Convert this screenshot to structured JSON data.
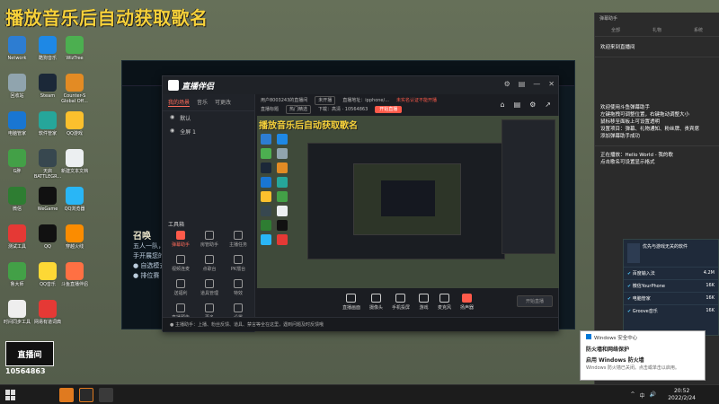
{
  "headline": "播放音乐后自动获取歌名",
  "desktop_icons": [
    {
      "label": "Network",
      "icon": "network-icon",
      "color": "#2d7dd2"
    },
    {
      "label": "酷狗音乐",
      "icon": "kugou-icon",
      "color": "#1e88e5"
    },
    {
      "label": "WizTree",
      "icon": "wiztree-icon",
      "color": "#4caf50"
    },
    {
      "label": "回收站",
      "icon": "recycle-bin-icon",
      "color": "#90a4ae"
    },
    {
      "label": "Steam",
      "icon": "steam-icon",
      "color": "#1b2838"
    },
    {
      "label": "Counter-S Global Off...",
      "icon": "csgo-icon",
      "color": "#e38b24"
    },
    {
      "label": "电脑管家",
      "icon": "pc-manager-icon",
      "color": "#1976d2"
    },
    {
      "label": "软件管家",
      "icon": "software-manager-icon",
      "color": "#26a69a"
    },
    {
      "label": "QQ游戏",
      "icon": "qq-game-icon",
      "color": "#fbc02d"
    },
    {
      "label": "G胖",
      "icon": "g-icon",
      "color": "#43a047"
    },
    {
      "label": "天启 BATTLEGR...",
      "icon": "battlegrounds-icon",
      "color": "#37474f"
    },
    {
      "label": "新建文本文档",
      "icon": "text-doc-icon",
      "color": "#eceff1"
    },
    {
      "label": "微信",
      "icon": "wechat-icon",
      "color": "#2e7d32"
    },
    {
      "label": "WeGame",
      "icon": "wegame-icon",
      "color": "#111111"
    },
    {
      "label": "QQ浏览器",
      "icon": "qq-browser-icon",
      "color": "#29b6f6"
    },
    {
      "label": "测试工具",
      "icon": "test-tool-icon",
      "color": "#e53935"
    },
    {
      "label": "QQ",
      "icon": "qq-icon",
      "color": "#111111"
    },
    {
      "label": "穿越火线",
      "icon": "crossfire-icon",
      "color": "#fb8c00"
    },
    {
      "label": "鲁大师",
      "icon": "ludashi-icon",
      "color": "#43a047"
    },
    {
      "label": "QQ音乐",
      "icon": "qq-music-icon",
      "color": "#fdd835"
    },
    {
      "label": "斗鱼直播伴侣",
      "icon": "douyu-icon",
      "color": "#ff7043"
    },
    {
      "label": "时间同步工具",
      "icon": "time-sync-icon",
      "color": "#eeeeee"
    },
    {
      "label": "网易有道词典",
      "icon": "youdao-icon",
      "color": "#e53935"
    }
  ],
  "watermark": {
    "logo_text": "直播间",
    "number": "10564863"
  },
  "game_client": {
    "big_text": "召唤",
    "line1": "五人一队，",
    "line2": "手开展您的",
    "line3": "● 自选模式",
    "line4": "● 排位赛"
  },
  "app": {
    "brand": "直播伴侣",
    "window_controls": [
      "⚙",
      "▤",
      "—",
      "✕"
    ],
    "tabs": [
      "我的场景",
      "音乐",
      "可更改"
    ],
    "scenes": [
      {
        "label": "默认"
      },
      {
        "label": "全屏 1"
      }
    ],
    "tools_label": "工具箱",
    "tools": [
      {
        "label": "弹幕助手",
        "active": true
      },
      {
        "label": "房管助手",
        "active": false
      },
      {
        "label": "主播任务",
        "active": false
      },
      {
        "label": "视频连麦",
        "active": false
      },
      {
        "label": "点歌台",
        "active": false
      },
      {
        "label": "PK擂台",
        "active": false
      },
      {
        "label": "送福利",
        "active": false
      },
      {
        "label": "道具管理",
        "active": false
      },
      {
        "label": "特效",
        "active": false
      },
      {
        "label": "直播预告",
        "active": false
      },
      {
        "label": "更多",
        "active": false
      },
      {
        "label": "设置",
        "active": false
      }
    ],
    "info": {
      "user": "用户8003243的直播间",
      "status": "未开播",
      "link": "直播地址：ipphone/...",
      "warn": "未实名认证不能开播",
      "label2": "直播标题",
      "pill2": "热门精选",
      "detail2": "下载：高清 · 10564863",
      "button": "开始直播"
    },
    "action_icons": [
      "⌂",
      "▤",
      "⚙",
      "↗"
    ],
    "preview_title": "播放音乐后自动获取歌名",
    "bottom_buttons": [
      {
        "label": "直播画面",
        "active": false
      },
      {
        "label": "摄像头",
        "active": false
      },
      {
        "label": "手机投屏",
        "active": false
      },
      {
        "label": "游戏",
        "active": false
      },
      {
        "label": "麦克风",
        "active": false
      },
      {
        "label": "扬声器",
        "active": true
      }
    ],
    "start_live": "开始直播",
    "status_text": "● 主播助手：上播、粉丝反馈、道具、禁言等全在这里，遇到问题及时反馈哦"
  },
  "notification_panel": {
    "head": "弹幕助手",
    "tabs": [
      "全部",
      "礼物",
      "系统"
    ],
    "block1": "欢迎来到直播间",
    "block2_lines": [
      "欢迎使用斗鱼弹幕助手",
      "左键拖拽可调整位置，右键拖动调整大小",
      "鼠标移至面板上可设置透明",
      "设置项目：弹幕、礼物通知、粉丝牌、贵宾席",
      "添加弹幕助手成功"
    ],
    "block3_lines": [
      "正在播放：Hello World - 我的歌",
      "点击歌名可设置显示格式"
    ]
  },
  "popup": {
    "title": "优先与游戏无关的软件",
    "rows": [
      {
        "label": "百度输入法",
        "value": "4.2M"
      },
      {
        "label": "微信YourPhone",
        "value": "16K"
      },
      {
        "label": "电脑管家",
        "value": "16K"
      },
      {
        "label": "Groove音乐",
        "value": "16K"
      }
    ]
  },
  "win_security": {
    "app": "Windows 安全中心",
    "line1": "防火墙和网络保护",
    "line2": "启用 Windows 防火墙",
    "line3": "Windows 防火墙已关闭。点击或单击以启用。"
  },
  "taskbar": {
    "time": "20:52",
    "date": "2022/2/24",
    "tray": [
      "^",
      "中",
      "🔊"
    ]
  }
}
